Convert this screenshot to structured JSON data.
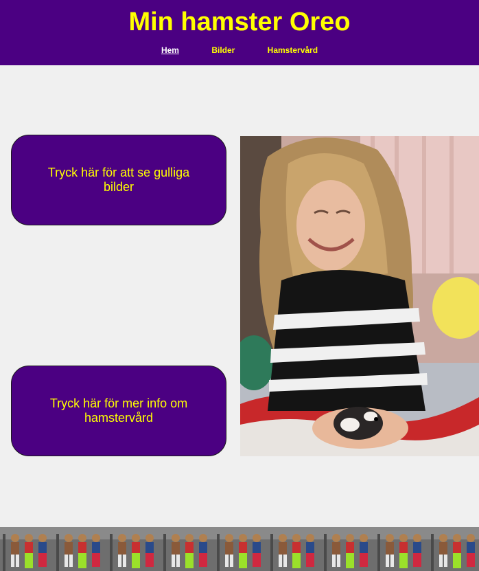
{
  "header": {
    "title": "Min hamster Oreo",
    "nav": [
      {
        "label": "Hem",
        "active": true
      },
      {
        "label": "Bilder",
        "active": false
      },
      {
        "label": "Hamstervård",
        "active": false
      }
    ]
  },
  "cards": {
    "pictures": "Tryck här för att se gulliga bilder",
    "care": "Tryck här för mer info om hamstervård"
  },
  "colors": {
    "brand": "#4b0082",
    "accent": "#ffff00",
    "background": "#f0f0f0"
  }
}
